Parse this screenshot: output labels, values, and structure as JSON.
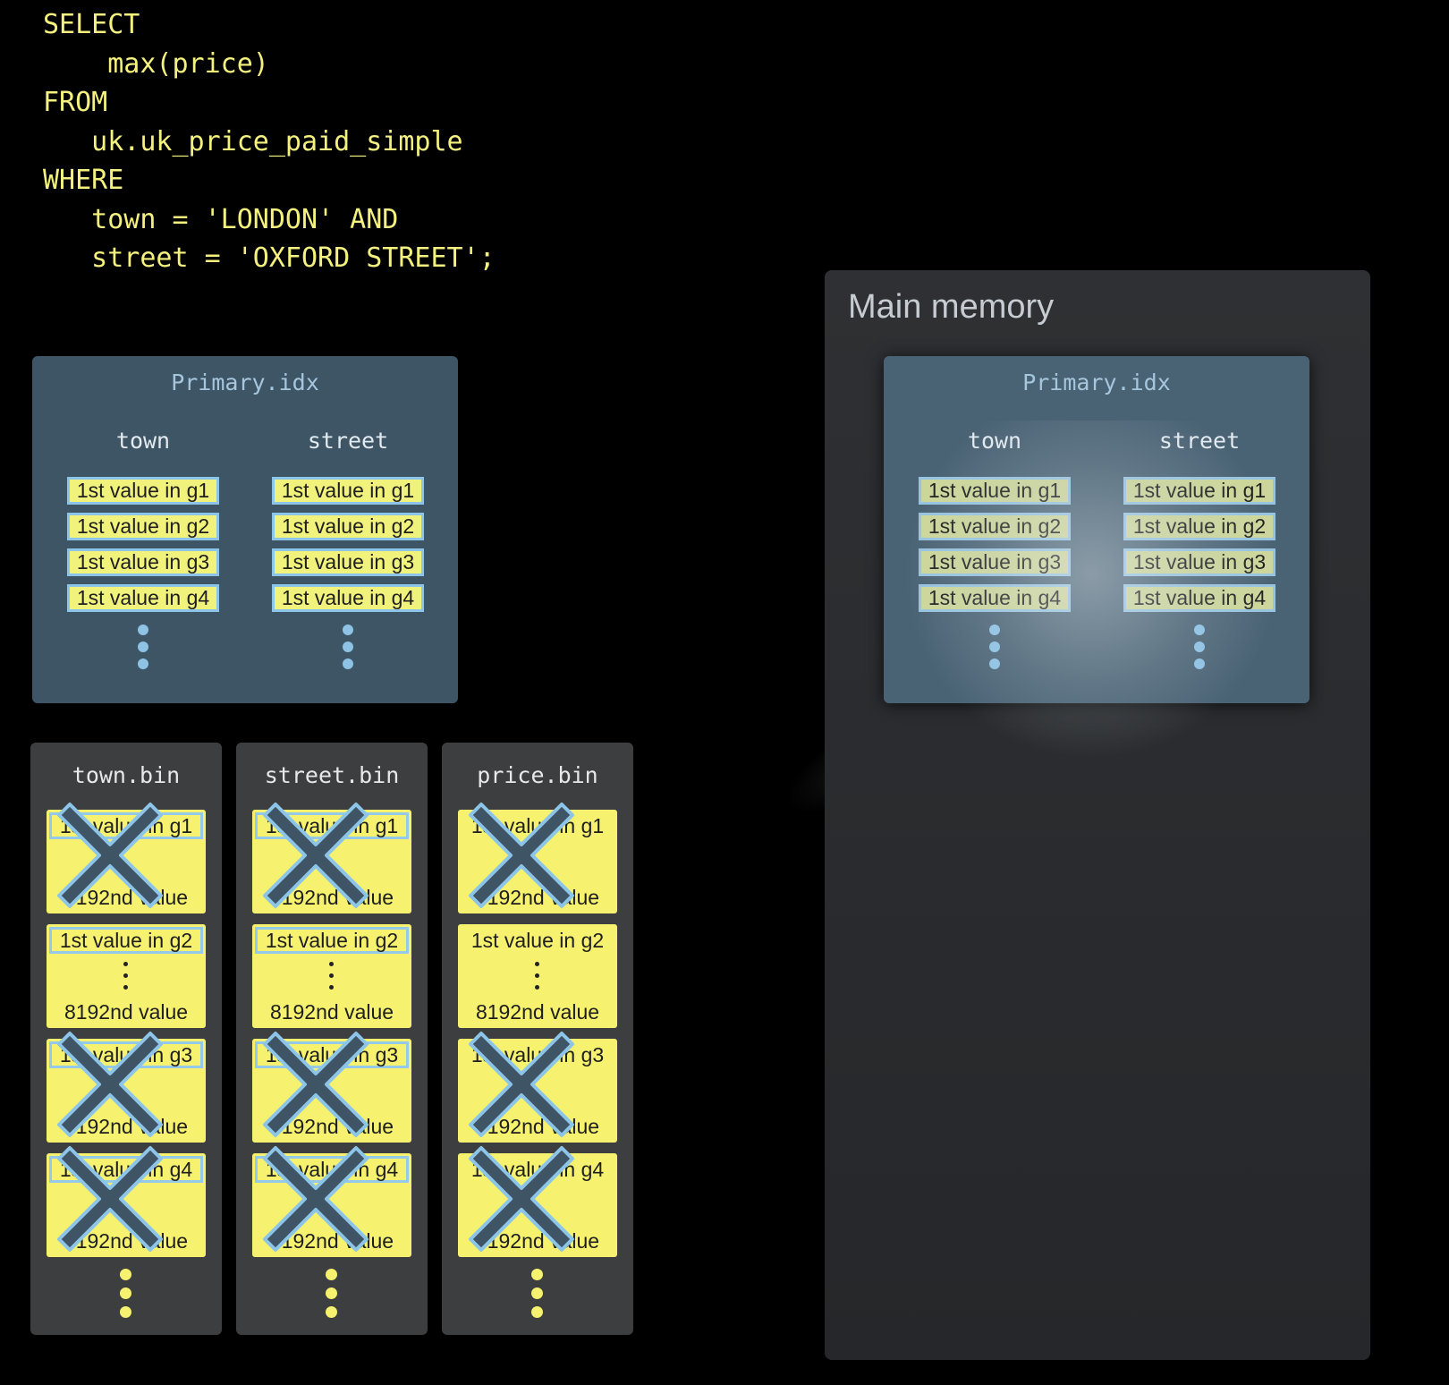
{
  "query": {
    "lines": [
      "SELECT",
      "    max(price)",
      "FROM",
      "   uk.uk_price_paid_simple",
      "WHERE",
      "   town = 'LONDON' AND",
      "   street = 'OXFORD STREET';"
    ]
  },
  "primary_index": {
    "title": "Primary.idx",
    "columns": [
      {
        "name": "town",
        "entries": [
          "1st value in g1",
          "1st value in g2",
          "1st value in g3",
          "1st value in g4"
        ]
      },
      {
        "name": "street",
        "entries": [
          "1st value in g1",
          "1st value in g2",
          "1st value in g3",
          "1st value in g4"
        ]
      }
    ]
  },
  "main_memory": {
    "label": "Main memory",
    "primary_index": {
      "title": "Primary.idx",
      "columns": [
        {
          "name": "town",
          "entries": [
            "1st value in g1",
            "1st value in g2",
            "1st value in g3",
            "1st value in g4"
          ]
        },
        {
          "name": "street",
          "entries": [
            "1st value in g1",
            "1st value in g2",
            "1st value in g3",
            "1st value in g4"
          ]
        }
      ]
    }
  },
  "bins": [
    {
      "title": "town.bin",
      "granules": [
        {
          "first": "1st value in g1",
          "last": "8192nd value",
          "excluded": true,
          "first_outlined": true
        },
        {
          "first": "1st value in g2",
          "last": "8192nd value",
          "excluded": false,
          "first_outlined": true
        },
        {
          "first": "1st value in g3",
          "last": "8192nd value",
          "excluded": true,
          "first_outlined": true
        },
        {
          "first": "1st value in g4",
          "last": "8192nd value",
          "excluded": true,
          "first_outlined": true
        }
      ]
    },
    {
      "title": "street.bin",
      "granules": [
        {
          "first": "1st value in g1",
          "last": "8192nd value",
          "excluded": true,
          "first_outlined": true
        },
        {
          "first": "1st value in g2",
          "last": "8192nd value",
          "excluded": false,
          "first_outlined": true
        },
        {
          "first": "1st value in g3",
          "last": "8192nd value",
          "excluded": true,
          "first_outlined": true
        },
        {
          "first": "1st value in g4",
          "last": "8192nd value",
          "excluded": true,
          "first_outlined": true
        }
      ]
    },
    {
      "title": "price.bin",
      "granules": [
        {
          "first": "1st value in g1",
          "last": "8192nd value",
          "excluded": true,
          "first_outlined": false
        },
        {
          "first": "1st value in g2",
          "last": "8192nd value",
          "excluded": false,
          "first_outlined": false
        },
        {
          "first": "1st value in g3",
          "last": "8192nd value",
          "excluded": true,
          "first_outlined": false
        },
        {
          "first": "1st value in g4",
          "last": "8192nd value",
          "excluded": true,
          "first_outlined": false
        }
      ]
    }
  ],
  "colors": {
    "code_text": "#f4f17e",
    "index_panel": "#3e5566",
    "granule_fill": "#f6f16e",
    "mark_outline": "#8dc5e8",
    "cross_fill": "#3f5566"
  },
  "icons": {
    "excluded_marker": "cross-icon",
    "continuation": "vertical-ellipsis-icon"
  }
}
